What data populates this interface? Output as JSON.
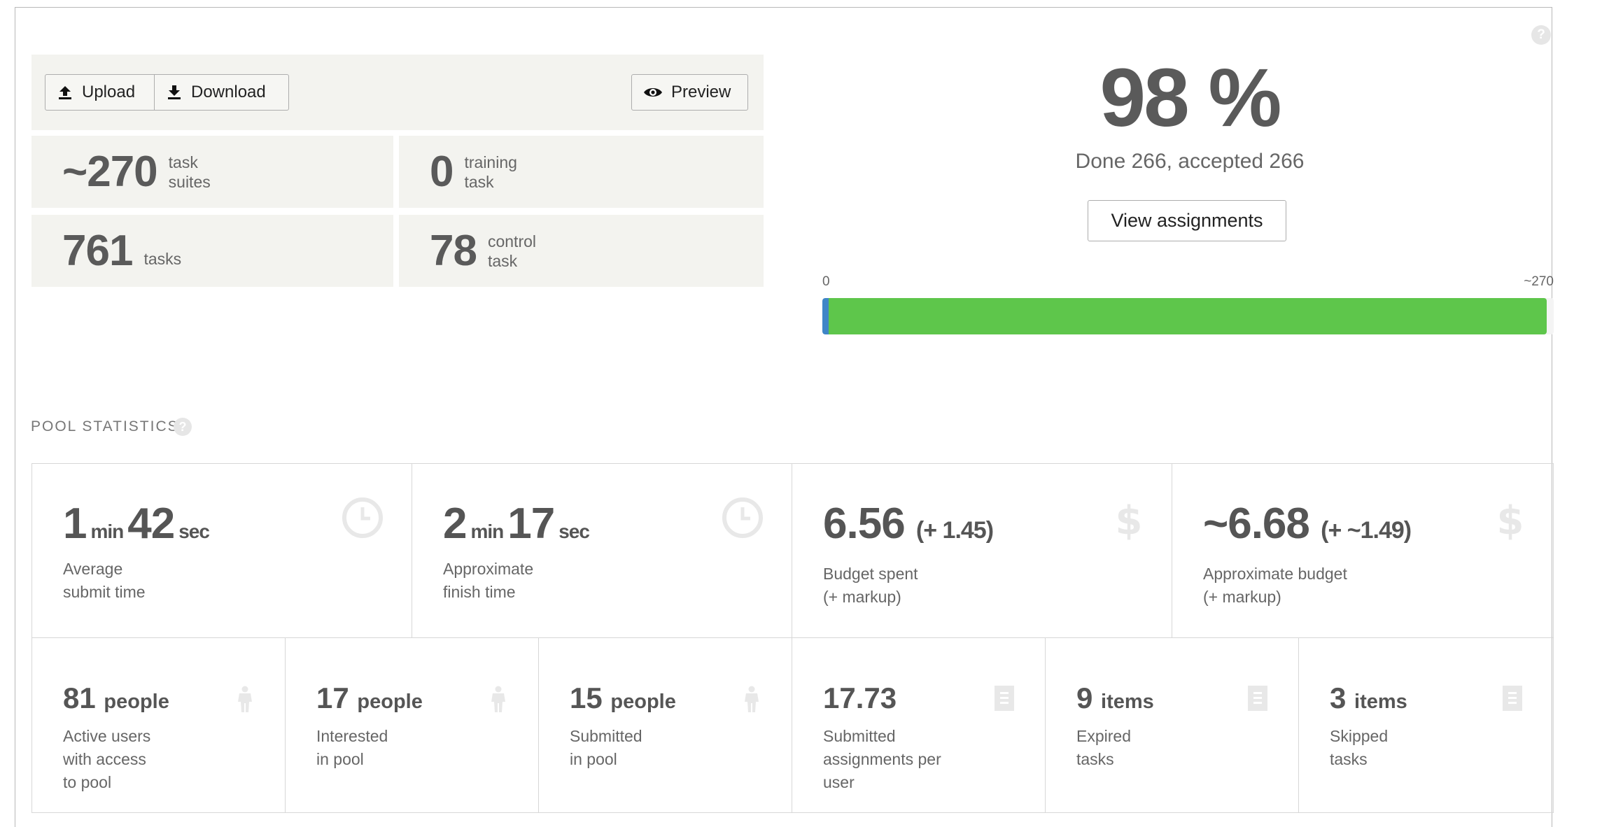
{
  "toolbar": {
    "upload_label": "Upload",
    "download_label": "Download",
    "preview_label": "Preview"
  },
  "counts": {
    "task_suites": {
      "value": "~270",
      "label_line1": "task",
      "label_line2": "suites"
    },
    "training": {
      "value": "0",
      "label_line1": "training",
      "label_line2": "task"
    },
    "tasks": {
      "value": "761",
      "label": "tasks"
    },
    "control": {
      "value": "78",
      "label_line1": "control",
      "label_line2": "task"
    }
  },
  "summary": {
    "percent": "98 %",
    "done_text": "Done 266, accepted 266",
    "view_button": "View assignments",
    "axis_min": "0",
    "axis_max": "~270",
    "progress_fraction": 0.99
  },
  "pool_statistics": {
    "title": "POOL STATISTICS",
    "top_row": [
      {
        "parts": [
          "1",
          "min",
          "42",
          "sec"
        ],
        "label_line1": "Average",
        "label_line2": "submit time",
        "icon": "clock-icon"
      },
      {
        "parts": [
          "2",
          "min",
          "17",
          "sec"
        ],
        "label_line1": "Approximate",
        "label_line2": "finish time",
        "icon": "clock-icon"
      },
      {
        "value": "6.56",
        "extra": "(+ 1.45)",
        "label_line1": "Budget spent",
        "label_line2": "(+ markup)",
        "icon": "dollar-icon"
      },
      {
        "value": "~6.68",
        "extra": "(+ ~1.49)",
        "label_line1": "Approximate budget",
        "label_line2": "(+ markup)",
        "icon": "dollar-icon"
      }
    ],
    "bottom_row": [
      {
        "value": "81",
        "unit": "people",
        "label_lines": [
          "Active users",
          "with access",
          "to pool"
        ],
        "icon": "person-icon"
      },
      {
        "value": "17",
        "unit": "people",
        "label_lines": [
          "Interested",
          "in pool"
        ],
        "icon": "person-icon"
      },
      {
        "value": "15",
        "unit": "people",
        "label_lines": [
          "Submitted",
          "in pool"
        ],
        "icon": "person-icon"
      },
      {
        "value": "17.73",
        "unit": "",
        "label_lines": [
          "Submitted",
          "assignments per",
          "user"
        ],
        "icon": "document-icon"
      },
      {
        "value": "9",
        "unit": "items",
        "label_lines": [
          "Expired",
          "tasks"
        ],
        "icon": "document-icon"
      },
      {
        "value": "3",
        "unit": "items",
        "label_lines": [
          "Skipped",
          "tasks"
        ],
        "icon": "document-icon"
      }
    ]
  },
  "colors": {
    "progress_green": "#5ec64b",
    "progress_blue": "#3f86c7",
    "panel_bg": "#f3f3ef"
  }
}
